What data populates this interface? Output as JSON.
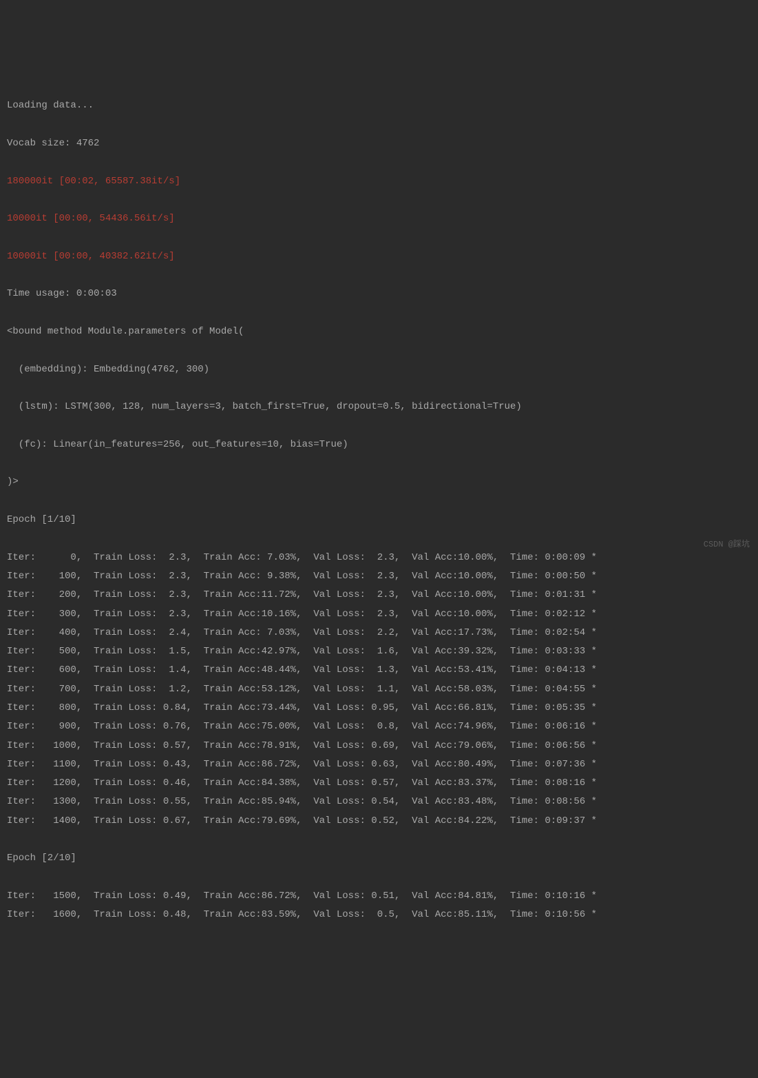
{
  "header": {
    "loading": "Loading data...",
    "vocab": "Vocab size: 4762",
    "progress1": "180000it [00:02, 65587.38it/s]",
    "progress2": "10000it [00:00, 54436.56it/s]",
    "progress3": "10000it [00:00, 40382.62it/s]",
    "time_usage": "Time usage: 0:00:03",
    "model_open": "<bound method Module.parameters of Model(",
    "embedding": "  (embedding): Embedding(4762, 300)",
    "lstm": "  (lstm): LSTM(300, 128, num_layers=3, batch_first=True, dropout=0.5, bidirectional=True)",
    "fc": "  (fc): Linear(in_features=256, out_features=10, bias=True)",
    "model_close": ")>",
    "epoch1": "Epoch [1/10]",
    "epoch2": "Epoch [2/10]"
  },
  "iters": [
    {
      "iter": 0,
      "train_loss": "2.3",
      "train_acc": "7.03",
      "val_loss": "2.3",
      "val_acc": "10.00",
      "time": "0:00:09"
    },
    {
      "iter": 100,
      "train_loss": "2.3",
      "train_acc": "9.38",
      "val_loss": "2.3",
      "val_acc": "10.00",
      "time": "0:00:50"
    },
    {
      "iter": 200,
      "train_loss": "2.3",
      "train_acc": "11.72",
      "val_loss": "2.3",
      "val_acc": "10.00",
      "time": "0:01:31"
    },
    {
      "iter": 300,
      "train_loss": "2.3",
      "train_acc": "10.16",
      "val_loss": "2.3",
      "val_acc": "10.00",
      "time": "0:02:12"
    },
    {
      "iter": 400,
      "train_loss": "2.4",
      "train_acc": "7.03",
      "val_loss": "2.2",
      "val_acc": "17.73",
      "time": "0:02:54"
    },
    {
      "iter": 500,
      "train_loss": "1.5",
      "train_acc": "42.97",
      "val_loss": "1.6",
      "val_acc": "39.32",
      "time": "0:03:33"
    },
    {
      "iter": 600,
      "train_loss": "1.4",
      "train_acc": "48.44",
      "val_loss": "1.3",
      "val_acc": "53.41",
      "time": "0:04:13"
    },
    {
      "iter": 700,
      "train_loss": "1.2",
      "train_acc": "53.12",
      "val_loss": "1.1",
      "val_acc": "58.03",
      "time": "0:04:55"
    },
    {
      "iter": 800,
      "train_loss": "0.84",
      "train_acc": "73.44",
      "val_loss": "0.95",
      "val_acc": "66.81",
      "time": "0:05:35"
    },
    {
      "iter": 900,
      "train_loss": "0.76",
      "train_acc": "75.00",
      "val_loss": "0.8",
      "val_acc": "74.96",
      "time": "0:06:16"
    },
    {
      "iter": 1000,
      "train_loss": "0.57",
      "train_acc": "78.91",
      "val_loss": "0.69",
      "val_acc": "79.06",
      "time": "0:06:56"
    },
    {
      "iter": 1100,
      "train_loss": "0.43",
      "train_acc": "86.72",
      "val_loss": "0.63",
      "val_acc": "80.49",
      "time": "0:07:36"
    },
    {
      "iter": 1200,
      "train_loss": "0.46",
      "train_acc": "84.38",
      "val_loss": "0.57",
      "val_acc": "83.37",
      "time": "0:08:16"
    },
    {
      "iter": 1300,
      "train_loss": "0.55",
      "train_acc": "85.94",
      "val_loss": "0.54",
      "val_acc": "83.48",
      "time": "0:08:56"
    },
    {
      "iter": 1400,
      "train_loss": "0.67",
      "train_acc": "79.69",
      "val_loss": "0.52",
      "val_acc": "84.22",
      "time": "0:09:37"
    }
  ],
  "iters2": [
    {
      "iter": 1500,
      "train_loss": "0.49",
      "train_acc": "86.72",
      "val_loss": "0.51",
      "val_acc": "84.81",
      "time": "0:10:16"
    },
    {
      "iter": 1600,
      "train_loss": "0.48",
      "train_acc": "83.59",
      "val_loss": "0.5",
      "val_acc": "85.11",
      "time": "0:10:56"
    }
  ],
  "watermark": "CSDN @踩坑"
}
